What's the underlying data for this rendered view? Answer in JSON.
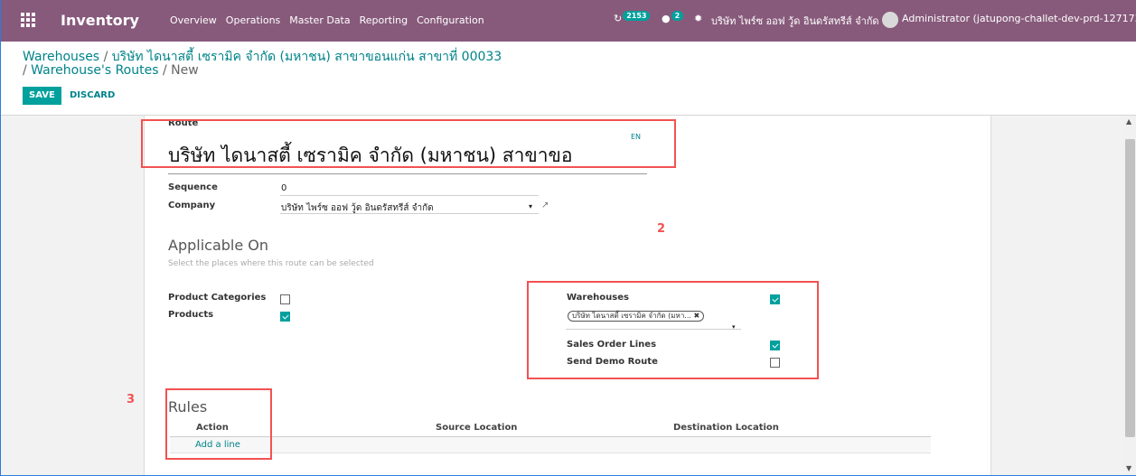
{
  "navbar": {
    "app_name": "Inventory",
    "menu": [
      "Overview",
      "Operations",
      "Master Data",
      "Reporting",
      "Configuration"
    ],
    "activity_count": "2153",
    "message_count": "2",
    "company_switcher": "บริษัท ไพร์ซ ออฟ วู้ด อินดรัสทรีส์ จำกัด",
    "user": "Administrator (jatupong-challet-dev-prd-1271733)"
  },
  "breadcrumb": {
    "warehouses": "Warehouses",
    "warehouse_name": "บริษัท ไดนาสตี้ เซรามิค จำกัด (มหาชน) สาขาขอนแก่น สาขาที่ 00033",
    "routes": "Warehouse's Routes",
    "current": "New",
    "separator": "/"
  },
  "buttons": {
    "save": "SAVE",
    "discard": "DISCARD"
  },
  "form": {
    "route_label": "Route",
    "route_name": "บริษัท ไดนาสตี้ เซรามิค จำกัด (มหาชน) สาขาขอ",
    "lang": "EN",
    "sequence_label": "Sequence",
    "sequence_value": "0",
    "company_label": "Company",
    "company_value": "บริษัท ไพร์ซ ออฟ วู้ด อินดรัสทรีส์ จำกัด",
    "applicable_title": "Applicable On",
    "applicable_help": "Select the places where this route can be selected",
    "product_categories_label": "Product Categories",
    "product_categories_checked": false,
    "products_label": "Products",
    "products_checked": true,
    "warehouses_label": "Warehouses",
    "warehouses_checked": true,
    "warehouse_tag": "บริษัท ไดนาสตี้ เซรามิค จำกัด (มหา...",
    "sales_order_lines_label": "Sales Order Lines",
    "sales_order_lines_checked": true,
    "send_demo_route_label": "Send Demo Route",
    "send_demo_route_checked": false,
    "rules_title": "Rules",
    "rules_columns": [
      "Action",
      "Source Location",
      "Destination Location"
    ],
    "add_line": "Add a line"
  },
  "annotations": {
    "two": "2",
    "three": "3"
  },
  "colors": {
    "navbar": "#875a7b",
    "accent": "#00a09d",
    "link": "#00838a",
    "annotation": "#f25252"
  }
}
